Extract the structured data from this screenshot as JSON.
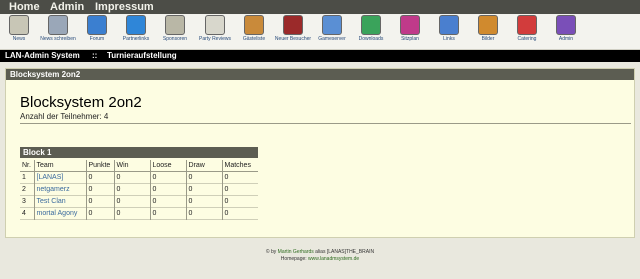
{
  "top_menu": [
    "Home",
    "Admin",
    "Impressum"
  ],
  "icons": [
    {
      "label": "News",
      "icon": "newspaper-icon",
      "color": "#c8c6b6"
    },
    {
      "label": "News schreiben",
      "icon": "write-news-icon",
      "color": "#9aa7b8"
    },
    {
      "label": "Forum",
      "icon": "forum-icon",
      "color": "#3b7fd0"
    },
    {
      "label": "Partnerlinks",
      "icon": "help-icon",
      "color": "#2f86d8"
    },
    {
      "label": "Sponsoren",
      "icon": "sponsors-icon",
      "color": "#b9b7a6"
    },
    {
      "label": "Party Reviews",
      "icon": "reviews-icon",
      "color": "#d8d7cc"
    },
    {
      "label": "Gästeliste",
      "icon": "cookie-icon",
      "color": "#c98a3a"
    },
    {
      "label": "Neuer Besucher",
      "icon": "new-visitor-icon",
      "color": "#9b2a2a"
    },
    {
      "label": "Gameserver",
      "icon": "gameserver-icon",
      "color": "#5a8fd4"
    },
    {
      "label": "Downloads",
      "icon": "downloads-icon",
      "color": "#3aa35b"
    },
    {
      "label": "Sitzplan",
      "icon": "seating-icon",
      "color": "#c03a8a"
    },
    {
      "label": "Links",
      "icon": "links-icon",
      "color": "#4a7fcf"
    },
    {
      "label": "Bilder",
      "icon": "pictures-icon",
      "color": "#d08a2e"
    },
    {
      "label": "Catering",
      "icon": "catering-icon",
      "color": "#d23c3c"
    },
    {
      "label": "Admin",
      "icon": "admin-icon",
      "color": "#7a4fb8"
    }
  ],
  "breadcrumb": {
    "root": "LAN-Admin System",
    "sep": "::",
    "current": "Turnieraufstellung"
  },
  "panel": {
    "header": "Blocksystem 2on2",
    "title": "Blocksystem 2on2",
    "participants": "Anzahl der Teilnehmer: 4"
  },
  "block": {
    "title": "Block 1",
    "columns": [
      "Nr.",
      "Team",
      "Punkte",
      "Win",
      "Loose",
      "Draw",
      "Matches"
    ],
    "rows": [
      {
        "nr": "1",
        "team": "[LANAS]",
        "punkte": "0",
        "win": "0",
        "loose": "0",
        "draw": "0",
        "matches": "0"
      },
      {
        "nr": "2",
        "team": "netgamerz",
        "punkte": "0",
        "win": "0",
        "loose": "0",
        "draw": "0",
        "matches": "0"
      },
      {
        "nr": "3",
        "team": "Test Clan",
        "punkte": "0",
        "win": "0",
        "loose": "0",
        "draw": "0",
        "matches": "0"
      },
      {
        "nr": "4",
        "team": "mortal Agony",
        "punkte": "0",
        "win": "0",
        "loose": "0",
        "draw": "0",
        "matches": "0"
      }
    ]
  },
  "footer": {
    "line1_prefix": "© by",
    "author": "Martin Gerhards",
    "line1_suffix": "alias [LANAS]THE_BRAIN",
    "line2_prefix": "Homepage:",
    "homepage": "www.lanadmsystem.de"
  }
}
